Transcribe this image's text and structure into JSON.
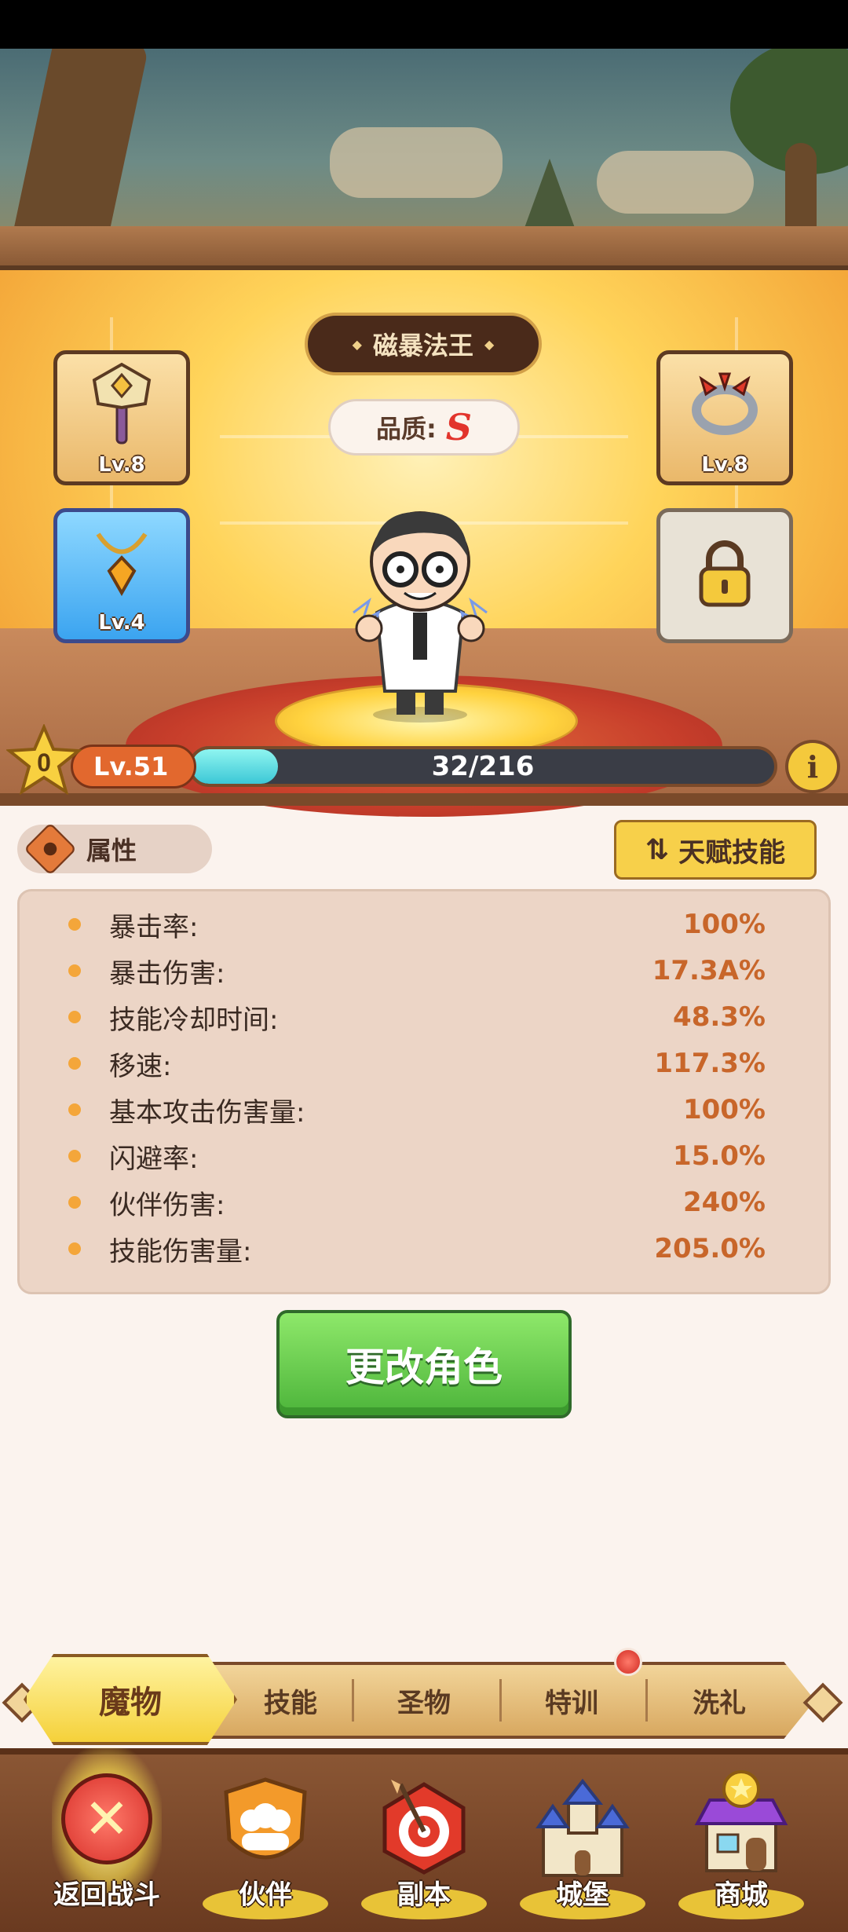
{
  "character": {
    "name": "磁暴法王",
    "quality_label": "品质:",
    "quality_grade": "S",
    "level": "Lv.51",
    "stars": "0",
    "xp_text": "32/216",
    "xp_fraction": 0.148
  },
  "equipment": {
    "hammer_level": "Lv.8",
    "ring_level": "Lv.8",
    "amulet_level": "Lv.4"
  },
  "attributes": {
    "tab_label": "属性",
    "talent_label": "天赋技能",
    "rows": [
      {
        "name": "暴击率:",
        "value": "100%"
      },
      {
        "name": "暴击伤害:",
        "value": "17.3A%"
      },
      {
        "name": "技能冷却时间:",
        "value": "48.3%"
      },
      {
        "name": "移速:",
        "value": "117.3%"
      },
      {
        "name": "基本攻击伤害量:",
        "value": "100%"
      },
      {
        "name": "闪避率:",
        "value": "15.0%"
      },
      {
        "name": "伙伴伤害:",
        "value": "240%"
      },
      {
        "name": "技能伤害量:",
        "value": "205.0%"
      }
    ]
  },
  "change_button": "更改角色",
  "tabs": [
    "魔物",
    "技能",
    "圣物",
    "特训",
    "洗礼"
  ],
  "nav": [
    "返回战斗",
    "伙伴",
    "副本",
    "城堡",
    "商城"
  ],
  "colors": {
    "accent_gold": "#f5d13a",
    "wood": "#7a4a2a",
    "value_orange": "#c8662a",
    "green_button": "#4cb43a"
  }
}
